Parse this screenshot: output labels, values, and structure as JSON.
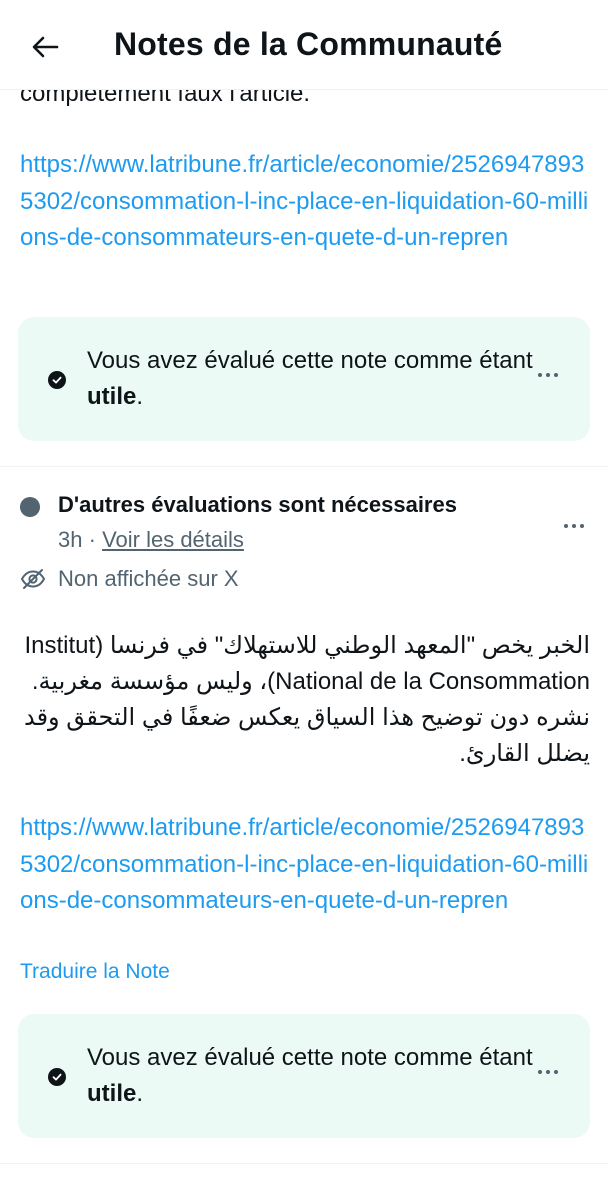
{
  "header": {
    "title": "Notes de la Communauté",
    "back_icon": "arrow-left-icon"
  },
  "note1": {
    "truncated_text": "complètement faux l'article.",
    "link": "https://www.latribune.fr/article/economie/25269478935302/consommation-l-inc-place-en-liquidation-60-millions-de-consommateurs-en-quete-d-un-repren",
    "rating": {
      "prefix": "Vous avez évalué cette note comme étant ",
      "value": "utile",
      "suffix": "."
    }
  },
  "note2": {
    "status": "D'autres évaluations sont nécessaires",
    "status_color": "#536471",
    "time": "3h",
    "separator": "·",
    "details_link": "Voir les détails",
    "visibility": "Non affichée sur X",
    "text": "الخبر يخص \"المعهد الوطني للاستهلاك\" في فرنسا (Institut National de la Consommation)، وليس مؤسسة مغربية. نشره دون توضيح هذا السياق يعكس ضعفًا في التحقق وقد يضلل القارئ.",
    "link": "https://www.latribune.fr/article/economie/25269478935302/consommation-l-inc-place-en-liquidation-60-millions-de-consommateurs-en-quete-d-un-repren",
    "translate": "Traduire la Note",
    "rating": {
      "prefix": "Vous avez évalué cette note comme étant ",
      "value": "utile",
      "suffix": "."
    }
  },
  "colors": {
    "link": "#1d9bf0",
    "rated_bg": "#ebfaf4",
    "secondary_text": "#536471"
  }
}
